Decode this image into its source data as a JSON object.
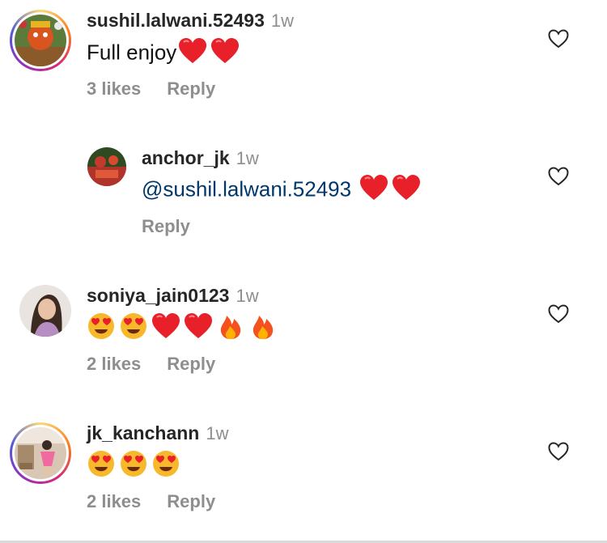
{
  "comments": [
    {
      "username": "sushil.lalwani.52493",
      "time": "1w",
      "text": "Full enjoy",
      "emojis": [
        "heart",
        "heart"
      ],
      "likes": "3 likes",
      "reply": "Reply"
    },
    {
      "username": "anchor_jk",
      "time": "1w",
      "mention": "@sushil.lalwani.52493",
      "emojis": [
        "heart",
        "heart"
      ],
      "reply": "Reply"
    },
    {
      "username": "soniya_jain0123",
      "time": "1w",
      "emojis": [
        "heart-eyes",
        "heart-eyes",
        "heart",
        "heart",
        "fire",
        "fire"
      ],
      "likes": "2 likes",
      "reply": "Reply"
    },
    {
      "username": "jk_kanchann",
      "time": "1w",
      "emojis": [
        "heart-eyes",
        "heart-eyes",
        "heart-eyes"
      ],
      "likes": "2 likes",
      "reply": "Reply"
    }
  ],
  "colors": {
    "username": "#262626",
    "muted": "#8e8e8e",
    "mention": "#00376b",
    "heart": "#e8202a"
  }
}
